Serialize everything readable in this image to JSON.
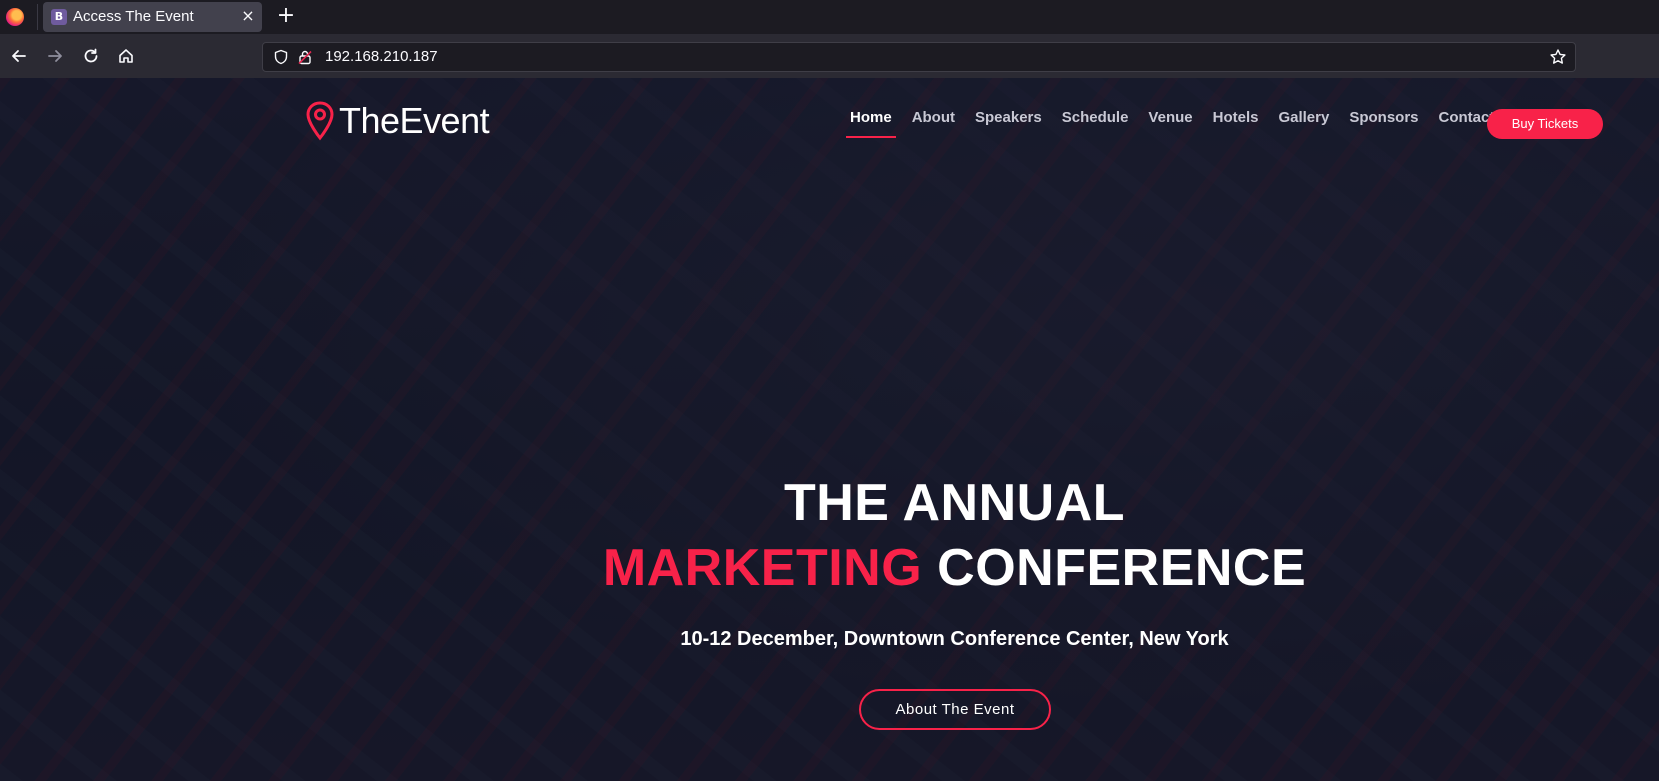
{
  "browser": {
    "tab": {
      "favicon_letter": "B",
      "title": "Access The Event"
    },
    "new_tab_label": "+",
    "close_label": "×",
    "url": "192.168.210.187"
  },
  "site": {
    "logo_text": "TheEvent",
    "menu": [
      {
        "label": "Home",
        "active": true
      },
      {
        "label": "About"
      },
      {
        "label": "Speakers"
      },
      {
        "label": "Schedule"
      },
      {
        "label": "Venue"
      },
      {
        "label": "Hotels"
      },
      {
        "label": "Gallery"
      },
      {
        "label": "Sponsors"
      },
      {
        "label": "Contact"
      }
    ],
    "buy_tickets_label": "Buy Tickets",
    "accent_color": "#f82249"
  },
  "hero": {
    "line1": "THE ANNUAL",
    "line2_accent": "MARKETING",
    "line2_rest": " CONFERENCE",
    "subtitle": "10-12 December, Downtown Conference Center, New York",
    "button_label": "About The Event"
  }
}
